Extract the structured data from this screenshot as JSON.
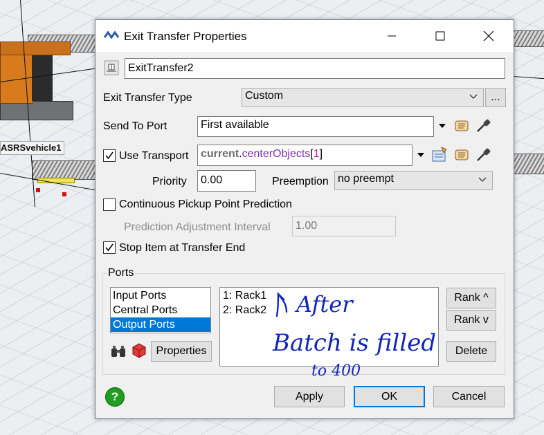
{
  "scene": {
    "vehicle_label": "ASRSvehicle1"
  },
  "dialog": {
    "title": "Exit Transfer Properties",
    "name_value": "ExitTransfer2",
    "exit_transfer_type_label": "Exit Transfer Type",
    "exit_transfer_type_value": "Custom",
    "more_button_label": "...",
    "send_to_port_label": "Send To Port",
    "send_to_port_value": "First available",
    "use_transport_label": "Use Transport",
    "use_transport_checked": true,
    "use_transport_value": {
      "keyword": "current",
      "dot": ".",
      "method": "centerObjects",
      "open": "[",
      "index": "1",
      "close": "]"
    },
    "priority_label": "Priority",
    "priority_value": "0.00",
    "preemption_label": "Preemption",
    "preemption_value": "no preempt",
    "continuous_label": "Continuous Pickup Point Prediction",
    "continuous_checked": false,
    "prediction_interval_label": "Prediction Adjustment Interval",
    "prediction_interval_value": "1.00",
    "stop_item_label": "Stop Item at Transfer End",
    "stop_item_checked": true,
    "ports_group_label": "Ports",
    "port_types": [
      "Input Ports",
      "Central Ports",
      "Output Ports"
    ],
    "selected_port_type": "Output Ports",
    "port_list": [
      "1:  Rack1",
      "2:  Rack2"
    ],
    "rank_up_label": "Rank ^",
    "rank_down_label": "Rank v",
    "delete_label": "Delete",
    "properties_label": "Properties",
    "apply_label": "Apply",
    "ok_label": "OK",
    "cancel_label": "Cancel"
  },
  "annotation": {
    "line1": "After",
    "line2": "Batch is filled",
    "line3": "to 400"
  },
  "colors": {
    "accent": "#0078d7",
    "keyword": "#6e6e6e",
    "method": "#7a2fb5",
    "handwriting": "#1326b8",
    "help": "#1f9e1f"
  }
}
